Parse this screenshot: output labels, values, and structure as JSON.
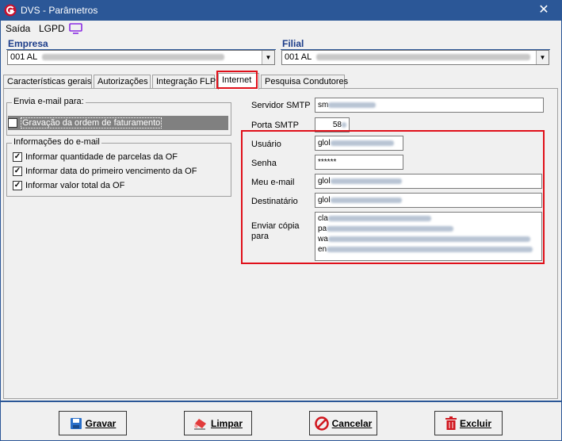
{
  "window": {
    "title": "DVS - Parâmetros"
  },
  "menu": {
    "items": [
      "Saída",
      "LGPD"
    ]
  },
  "empresa": {
    "label": "Empresa",
    "value": "001 AL"
  },
  "filial": {
    "label": "Filial",
    "value": "001 AL"
  },
  "tabs": [
    "Características gerais",
    "Autorizações",
    "Integração FLP",
    "Internet",
    "Pesquisa Condutores"
  ],
  "active_tab": "Internet",
  "envia_email": {
    "title": "Envia e-mail para:",
    "option": "Gravação da ordem de faturamento",
    "checked": true
  },
  "info_email": {
    "title": "Informações do e-mail",
    "options": [
      {
        "label": "Informar quantidade de parcelas da OF",
        "checked": true
      },
      {
        "label": "Informar data do primeiro vencimento da OF",
        "checked": true
      },
      {
        "label": "Informar valor total da OF",
        "checked": true
      }
    ]
  },
  "smtp": {
    "server_label": "Servidor SMTP",
    "server_value": "sm",
    "port_label": "Porta SMTP",
    "port_value": "58"
  },
  "credentials": {
    "user_label": "Usuário",
    "user_value": "glol",
    "password_label": "Senha",
    "password_value": "******",
    "my_email_label": "Meu e-mail",
    "my_email_value": "glol",
    "recipient_label": "Destinatário",
    "recipient_value": "glol",
    "cc_label": "Enviar cópia para",
    "cc_lines": [
      "cla",
      "pa",
      "wa",
      "en"
    ]
  },
  "buttons": {
    "save": "Gravar",
    "clear": "Limpar",
    "cancel": "Cancelar",
    "delete": "Excluir"
  },
  "colors": {
    "titlebar": "#2b5797",
    "highlight": "#e0101a",
    "header_text": "#1c3d8a"
  }
}
